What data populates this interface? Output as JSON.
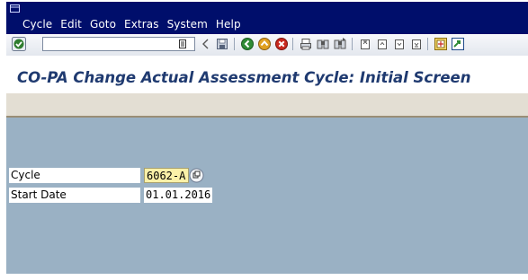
{
  "menu": {
    "items": [
      "Cycle",
      "Edit",
      "Goto",
      "Extras",
      "System",
      "Help"
    ]
  },
  "toolbar": {
    "command_value": ""
  },
  "page": {
    "title": "CO-PA Change Actual Assessment Cycle: Initial Screen"
  },
  "form": {
    "cycle_label": "Cycle",
    "cycle_value": "6062-A",
    "start_date_label": "Start Date",
    "start_date_value": "01.01.2016"
  },
  "colors": {
    "menubar": "#000e6b",
    "content_bg": "#9ab1c4",
    "required_field": "#fbf1a8",
    "title": "#1f3a70"
  },
  "icons": [
    "window-menu-icon",
    "enter-icon",
    "command-history-icon",
    "back-arrow-icon",
    "save-icon",
    "back-icon",
    "exit-icon",
    "cancel-icon",
    "print-icon",
    "find-icon",
    "find-next-icon",
    "first-page-icon",
    "previous-page-icon",
    "next-page-icon",
    "last-page-icon",
    "create-session-icon",
    "help-icon",
    "possible-entries-icon"
  ]
}
